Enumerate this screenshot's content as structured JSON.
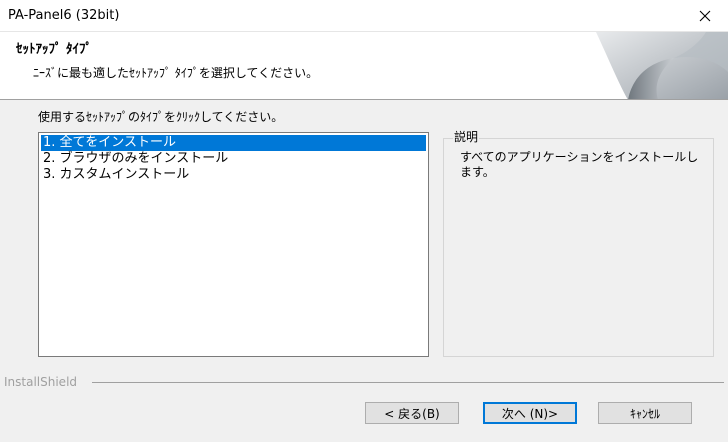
{
  "window": {
    "title": "PA-Panel6 (32bit)"
  },
  "header": {
    "title": "ｾｯﾄｱｯﾌﾟ ﾀｲﾌﾟ",
    "subtitle": "ﾆｰｽﾞに最も適したｾｯﾄｱｯﾌﾟ ﾀｲﾌﾟを選択してください。"
  },
  "main": {
    "instruction": "使用するｾｯﾄｱｯﾌﾟのﾀｲﾌﾟをｸﾘｯｸしてください。",
    "options": [
      "1. 全てをインストール",
      "2. ブラウザのみをインストール",
      "3. カスタムインストール"
    ],
    "selected_index": 0
  },
  "description": {
    "label": "説明",
    "text": "すべてのアプリケーションをインストールします。"
  },
  "footer": {
    "brand": "InstallShield",
    "back_label": "< 戻る(B)",
    "next_label": "次へ (N)>",
    "cancel_label": "ｷｬﾝｾﾙ"
  },
  "colors": {
    "selection": "#0078d7",
    "dialog_bg": "#f0f0f0"
  },
  "icons": {
    "close": "close-icon",
    "header_graphic": "page-curl-graphic"
  }
}
